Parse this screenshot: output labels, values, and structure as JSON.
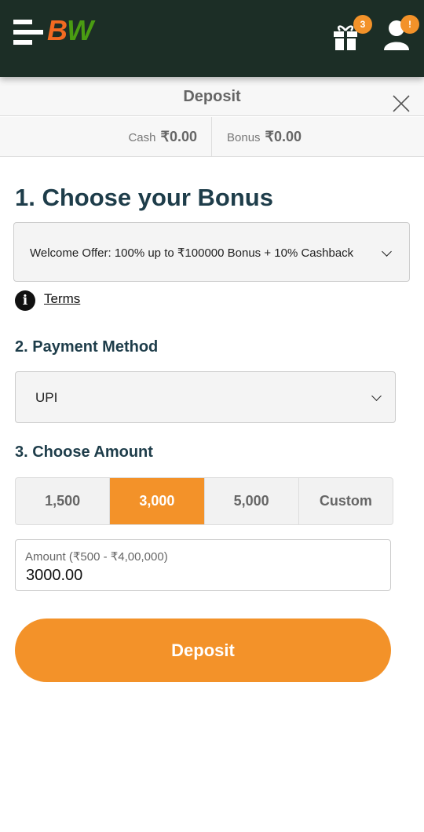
{
  "header": {
    "logo": "BW",
    "gift_badge": "3",
    "user_badge": "!"
  },
  "title": "Deposit",
  "balances": {
    "cash_label": "Cash",
    "cash_value": "₹0.00",
    "bonus_label": "Bonus",
    "bonus_value": "₹0.00"
  },
  "bonus": {
    "heading": "1. Choose your Bonus",
    "selected": "Welcome Offer: 100% up to ₹100000 Bonus + 10% Cashback",
    "terms": "Terms"
  },
  "payment": {
    "heading": "2. Payment Method",
    "selected": "UPI"
  },
  "amount": {
    "heading": "3. Choose Amount",
    "options": [
      "1,500",
      "3,000",
      "5,000",
      "Custom"
    ],
    "selected_index": 1,
    "field_label": "Amount (₹500 - ₹4,00,000)",
    "field_value": "3000.00"
  },
  "deposit_button": "Deposit",
  "colors": {
    "header_bg": "#1c2e26",
    "accent": "#f39229",
    "heading": "#1e3d4a"
  }
}
